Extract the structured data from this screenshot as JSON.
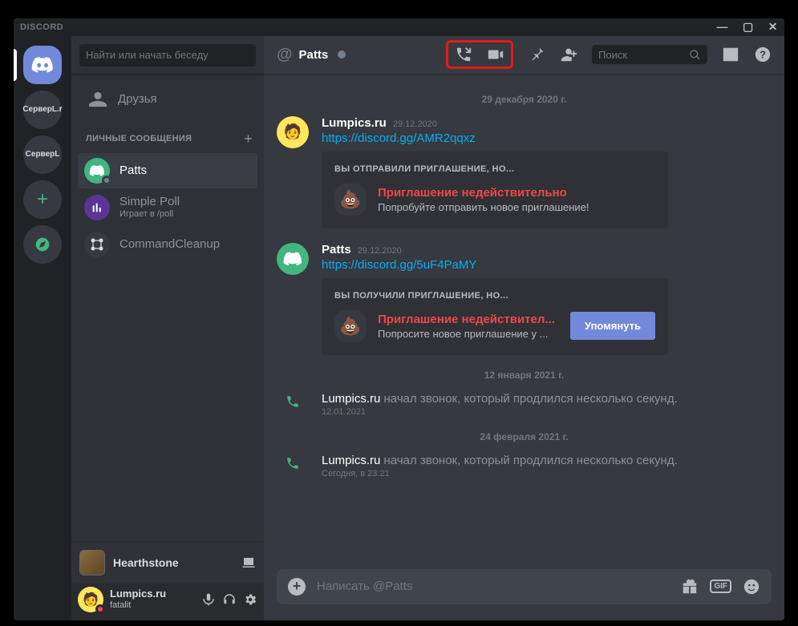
{
  "titlebar": {
    "brand": "DISCORD"
  },
  "sidebar": {
    "search_placeholder": "Найти или начать беседу",
    "friends_label": "Друзья",
    "dm_header": "ЛИЧНЫЕ СООБЩЕНИЯ",
    "dms": [
      {
        "name": "Patts"
      },
      {
        "name": "Simple Poll",
        "sub": "Играет в /poll"
      },
      {
        "name": "CommandCleanup"
      }
    ],
    "activity": {
      "name": "Hearthstone"
    },
    "user": {
      "name": "Lumpics.ru",
      "sub": "fatalit"
    }
  },
  "guilds": {
    "server1": "СерверL.r",
    "server2": "СерверL"
  },
  "header": {
    "title": "Patts",
    "search_placeholder": "Поиск"
  },
  "dates": {
    "d1": "29 декабря 2020 г.",
    "d2": "12 января 2021 г.",
    "d3": "24 февраля 2021 г."
  },
  "messages": {
    "m1": {
      "author": "Lumpics.ru",
      "time": "29.12.2020",
      "link": "https://discord.gg/AMR2qqxz",
      "invite": {
        "title": "ВЫ ОТПРАВИЛИ ПРИГЛАШЕНИЕ, НО...",
        "main": "Приглашение недействительно",
        "sub": "Попробуйте отправить новое приглашение!"
      }
    },
    "m2": {
      "author": "Patts",
      "time": "29.12.2020",
      "link": "https://discord.gg/5uF4PaMY",
      "invite": {
        "title": "ВЫ ПОЛУЧИЛИ ПРИГЛАШЕНИЕ, НО...",
        "main": "Приглашение недействител...",
        "sub": "Попросите новое приглашение у ...",
        "button": "Упомянуть"
      }
    },
    "s1": {
      "author": "Lumpics.ru",
      "text": " начал звонок, который продлился несколько секунд.",
      "time": "12.01.2021"
    },
    "s2": {
      "author": "Lumpics.ru",
      "text": " начал звонок, который продлился несколько секунд.",
      "time": "Сегодня, в 23:21"
    }
  },
  "input": {
    "placeholder": "Написать @Patts",
    "gif": "GIF"
  }
}
